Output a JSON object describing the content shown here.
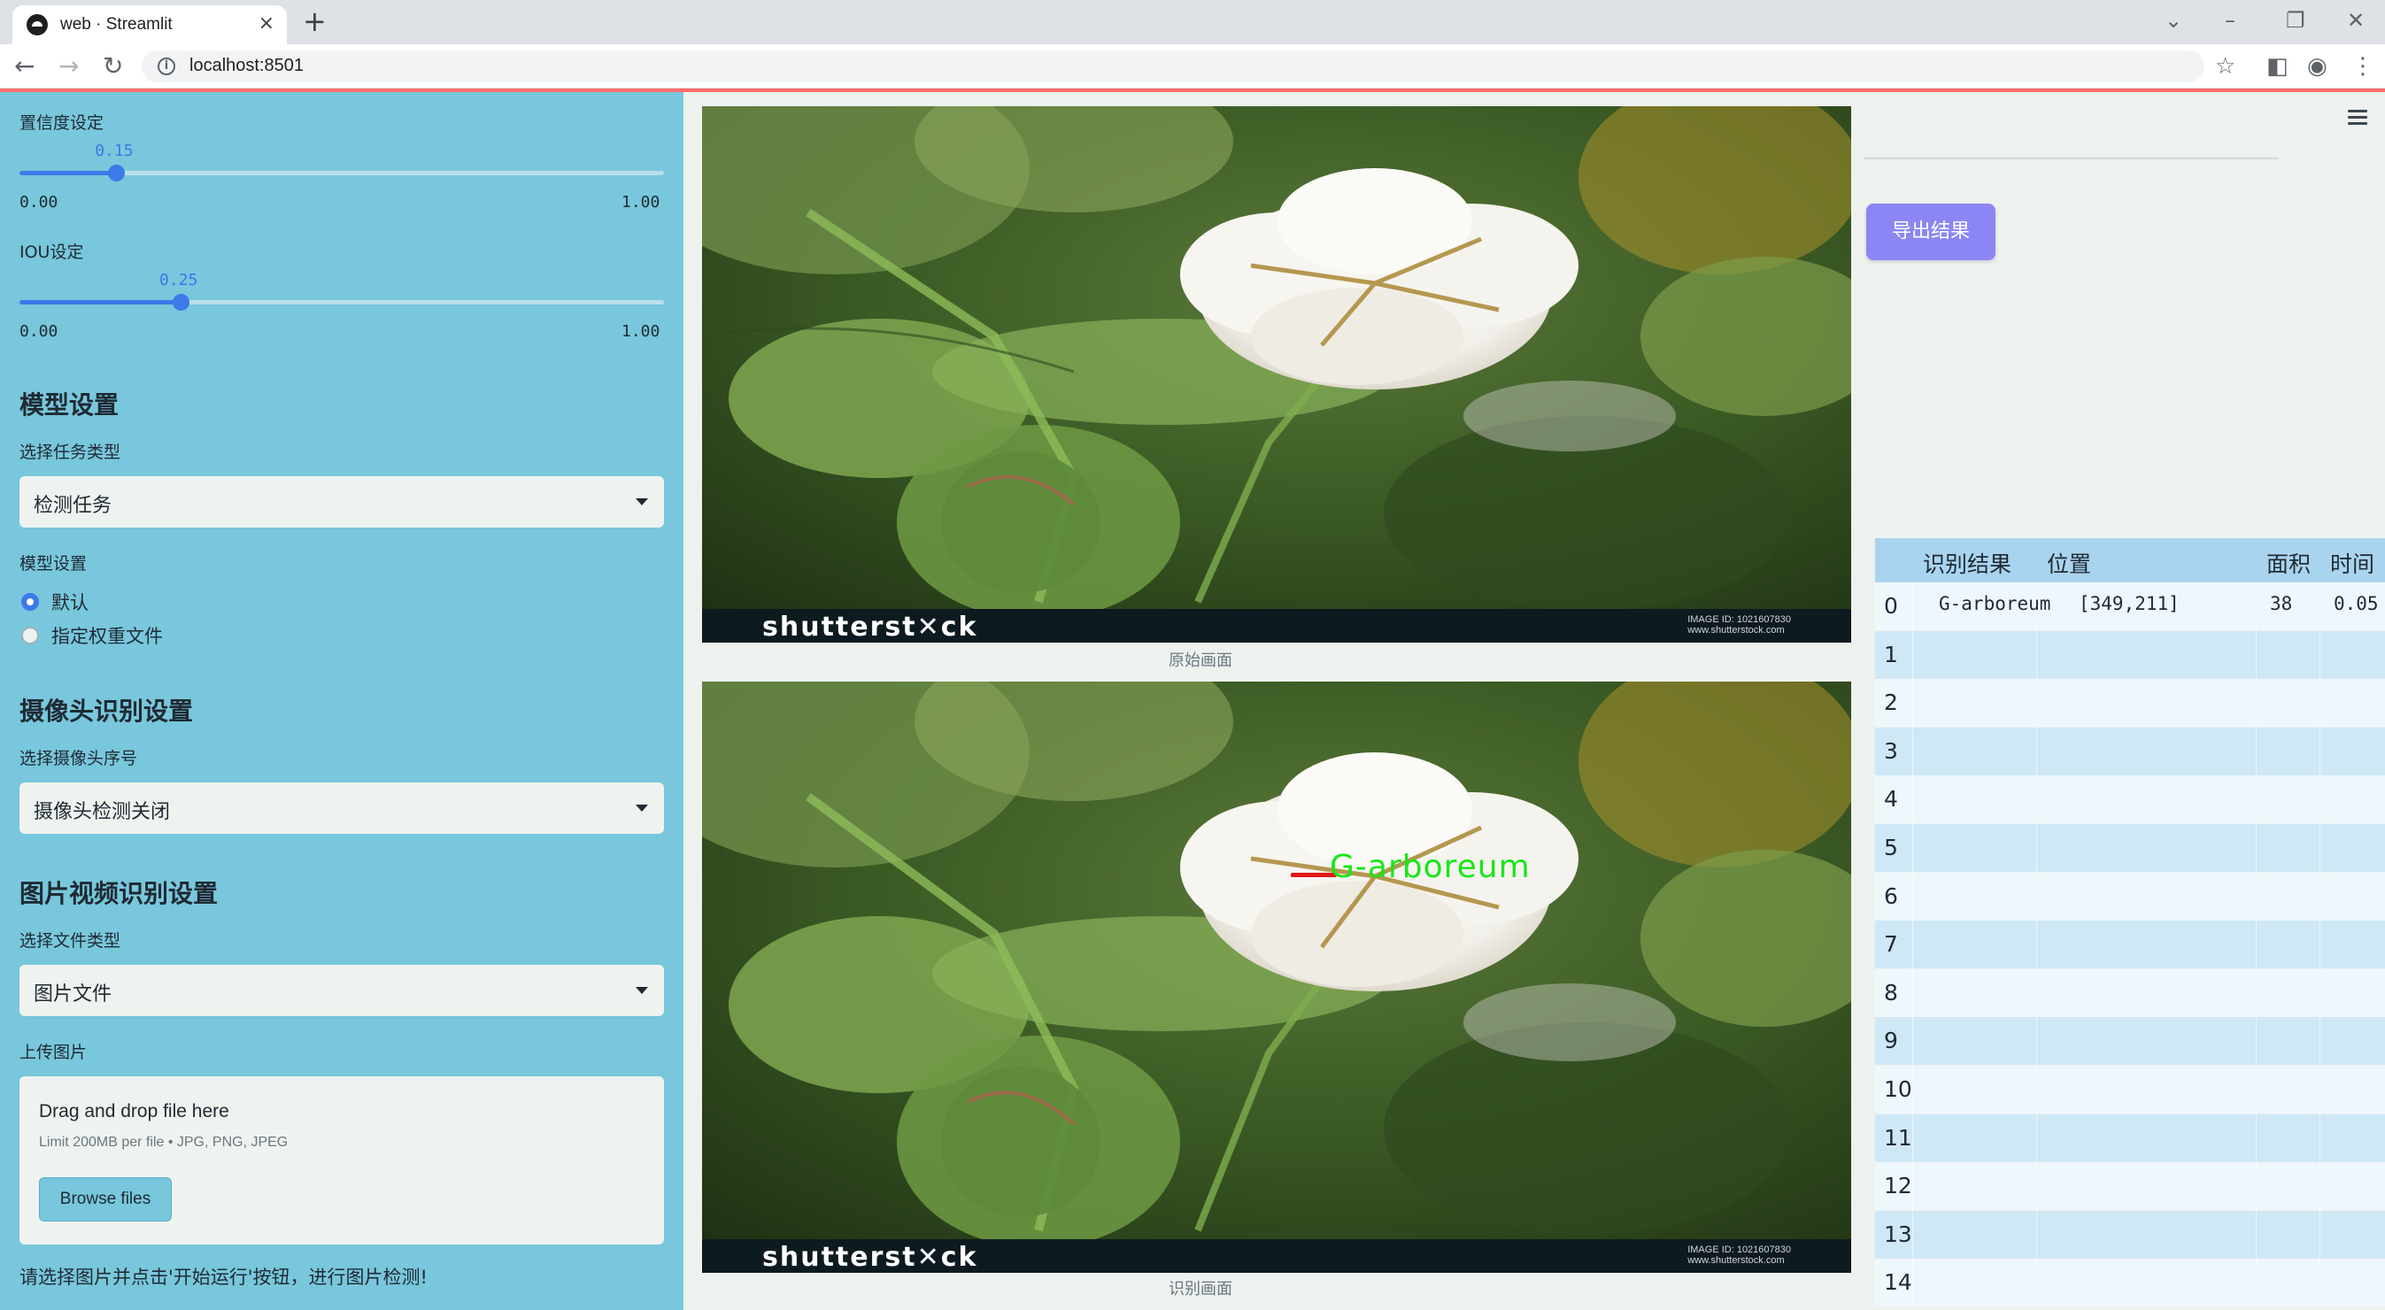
{
  "browser": {
    "tab_title": "web · Streamlit",
    "tab_close": "×",
    "new_tab": "+",
    "url": "localhost:8501",
    "window_controls": [
      "⌄",
      "–",
      "❐",
      "✕"
    ]
  },
  "sidebar": {
    "confidence": {
      "label": "置信度设定",
      "value_text": "0.15",
      "value": 0.15,
      "min": "0.00",
      "max": "1.00"
    },
    "iou": {
      "label": "IOU设定",
      "value_text": "0.25",
      "value": 0.25,
      "min": "0.00",
      "max": "1.00"
    },
    "model_section": {
      "heading": "模型设置",
      "task_label": "选择任务类型",
      "task_value": "检测任务",
      "model_label": "模型设置",
      "radio_options": [
        "默认",
        "指定权重文件"
      ],
      "radio_selected": 0
    },
    "camera_section": {
      "heading": "摄像头识别设置",
      "camera_label": "选择摄像头序号",
      "camera_value": "摄像头检测关闭"
    },
    "media_section": {
      "heading": "图片视频识别设置",
      "file_type_label": "选择文件类型",
      "file_type_value": "图片文件",
      "upload_label": "上传图片",
      "upload_title": "Drag and drop file here",
      "upload_limit": "Limit 200MB per file • JPG, PNG, JPEG",
      "browse_label": "Browse files"
    },
    "footer_hint": "请选择图片并点击'开始运行'按钮，进行图片检测!"
  },
  "main": {
    "original_caption": "原始画面",
    "result_caption": "识别画面",
    "watermark": "shutterst✕ck",
    "watermark_id": "IMAGE ID: 1021607830\nwww.shutterstock.com",
    "detection_label": "G-arboreum"
  },
  "right_panel": {
    "export_label": "导出结果",
    "table": {
      "headers": [
        "识别结果",
        "位置",
        "面积",
        "时间"
      ],
      "rows": [
        {
          "idx": "0",
          "result": "G-arboreum",
          "position": "[349,211]",
          "area": "38",
          "time": "0.05"
        },
        {
          "idx": "1"
        },
        {
          "idx": "2"
        },
        {
          "idx": "3"
        },
        {
          "idx": "4"
        },
        {
          "idx": "5"
        },
        {
          "idx": "6"
        },
        {
          "idx": "7"
        },
        {
          "idx": "8"
        },
        {
          "idx": "9"
        },
        {
          "idx": "10"
        },
        {
          "idx": "11"
        },
        {
          "idx": "12"
        },
        {
          "idx": "13"
        },
        {
          "idx": "14"
        }
      ]
    }
  },
  "colors": {
    "sidebar_bg": "#78c7dc",
    "accent": "#3d79e8",
    "export_btn": "#8b86f3",
    "detection_text": "#19e619",
    "detection_marker": "#e01919"
  }
}
